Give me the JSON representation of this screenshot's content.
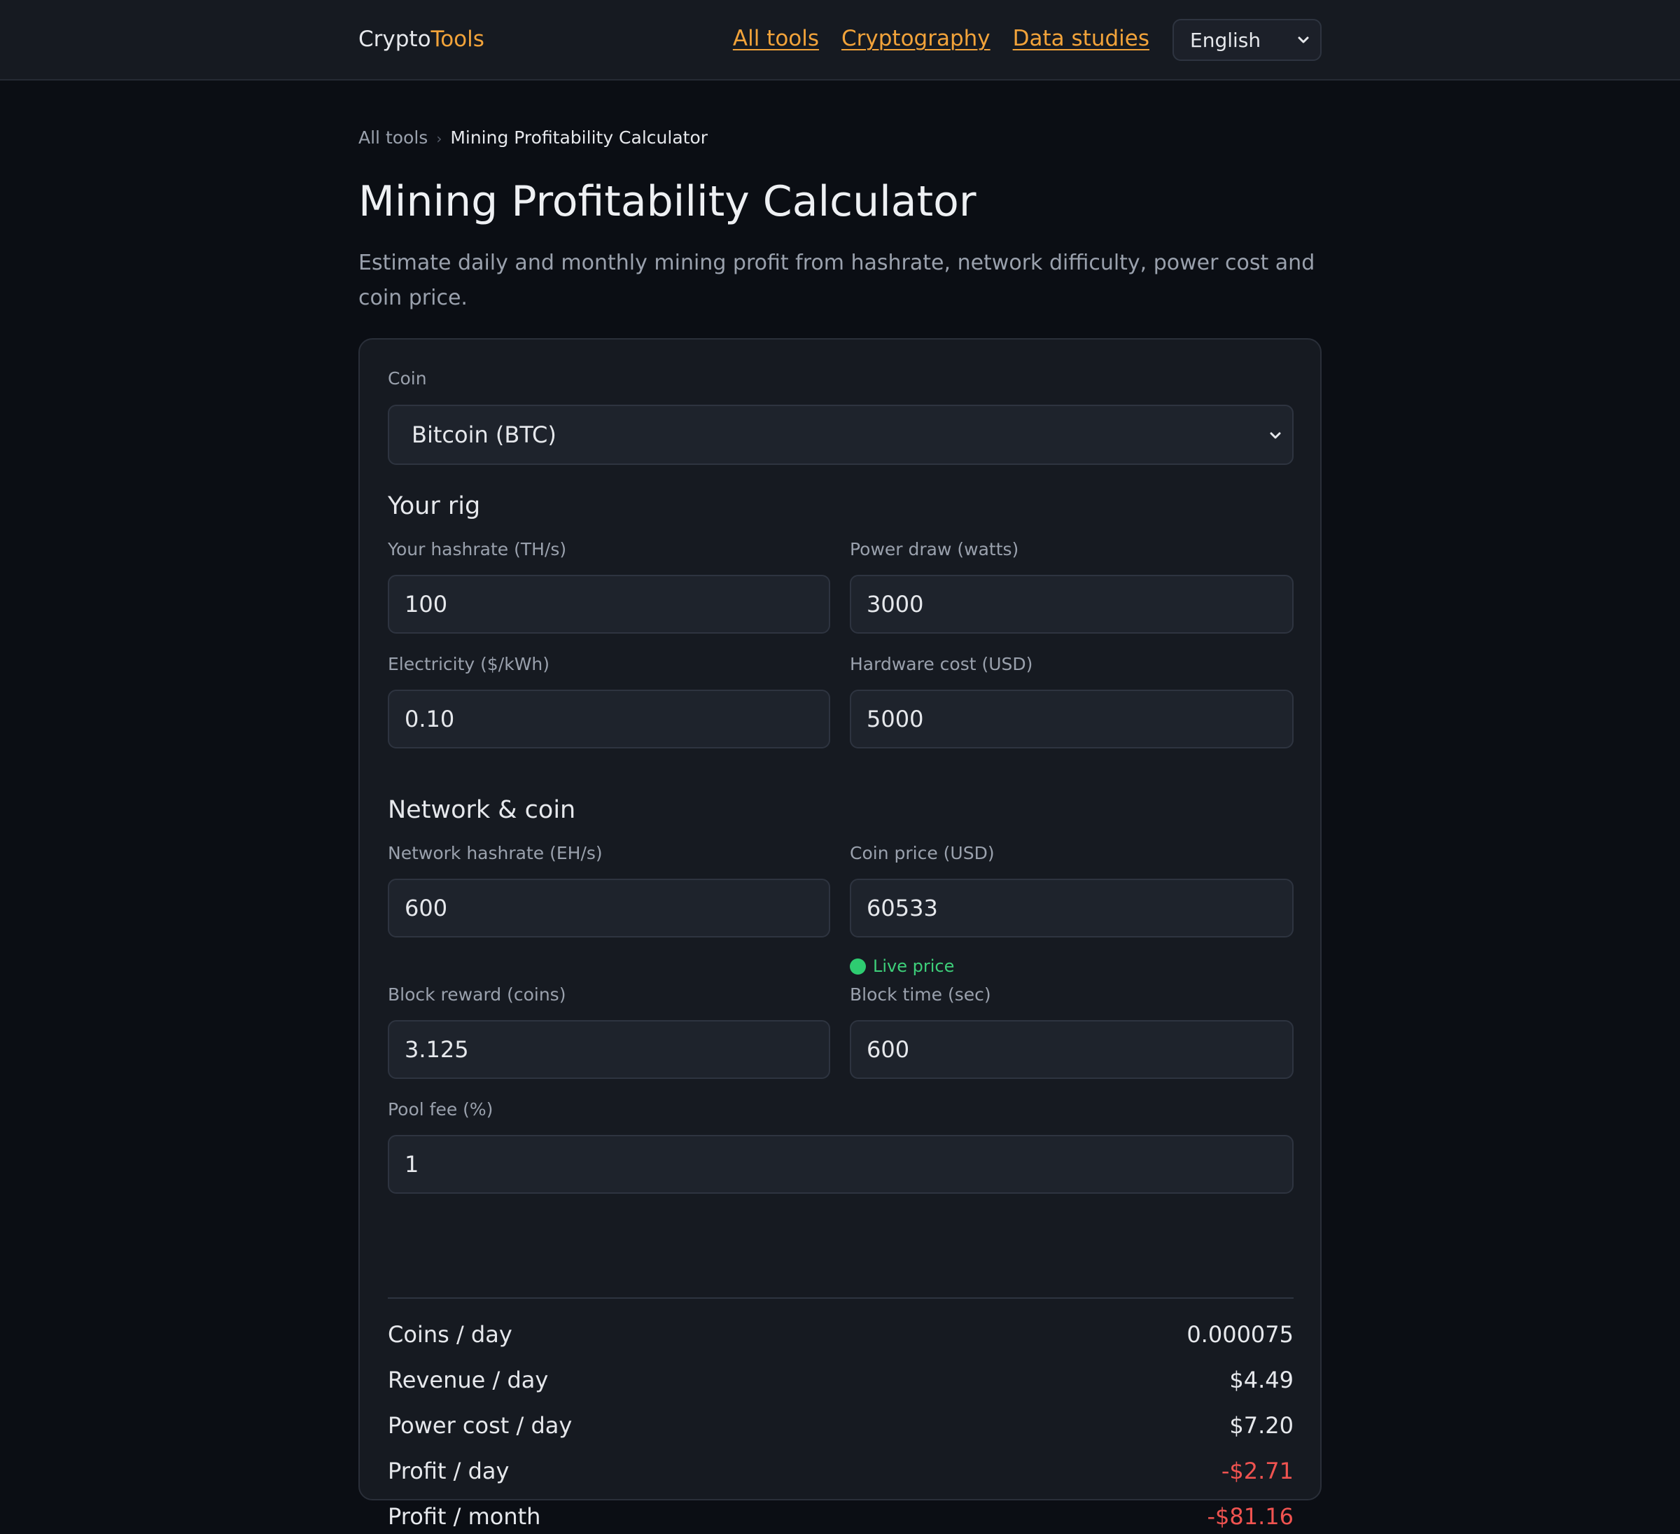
{
  "header": {
    "brand_prefix": "Crypto",
    "brand_suffix": "Tools",
    "nav": [
      {
        "label": "All tools"
      },
      {
        "label": "Cryptography"
      },
      {
        "label": "Data studies"
      }
    ],
    "language": {
      "selected": "English",
      "icon": "chevron-down-icon"
    }
  },
  "breadcrumb": {
    "parent": "All tools",
    "separator": "›",
    "current": "Mining Profitability Calculator"
  },
  "page": {
    "title": "Mining Profitability Calculator",
    "subtitle": "Estimate daily and monthly mining profit from hashrate, network difficulty, power cost and coin price."
  },
  "form": {
    "coin": {
      "label": "Coin",
      "selected": "Bitcoin (BTC)"
    },
    "rig": {
      "title": "Your rig",
      "hashrate": {
        "label": "Your hashrate (TH/s)",
        "value": "100"
      },
      "power": {
        "label": "Power draw (watts)",
        "value": "3000"
      },
      "electricity": {
        "label": "Electricity ($/kWh)",
        "value": "0.10"
      },
      "hardware": {
        "label": "Hardware cost (USD)",
        "value": "5000"
      }
    },
    "network": {
      "title": "Network & coin",
      "net_hashrate": {
        "label": "Network hashrate (EH/s)",
        "value": "600"
      },
      "coin_price": {
        "label": "Coin price (USD)",
        "value": "60533"
      },
      "live_price": "Live price",
      "block_reward": {
        "label": "Block reward (coins)",
        "value": "3.125"
      },
      "block_time": {
        "label": "Block time (sec)",
        "value": "600"
      },
      "pool_fee": {
        "label": "Pool fee (%)",
        "value": "1"
      }
    }
  },
  "results": [
    {
      "label": "Coins / day",
      "value": "0.000075",
      "status": "neutral"
    },
    {
      "label": "Revenue / day",
      "value": "$4.49",
      "status": "neutral"
    },
    {
      "label": "Power cost / day",
      "value": "$7.20",
      "status": "neutral"
    },
    {
      "label": "Profit / day",
      "value": "-$2.71",
      "status": "negative"
    },
    {
      "label": "Profit / month",
      "value": "-$81.16",
      "status": "negative"
    }
  ],
  "colors": {
    "background": "#0b0e14",
    "surface": "#161a21",
    "accent": "#f2a33a",
    "positive": "#2ecc71",
    "negative": "#ef5350"
  }
}
